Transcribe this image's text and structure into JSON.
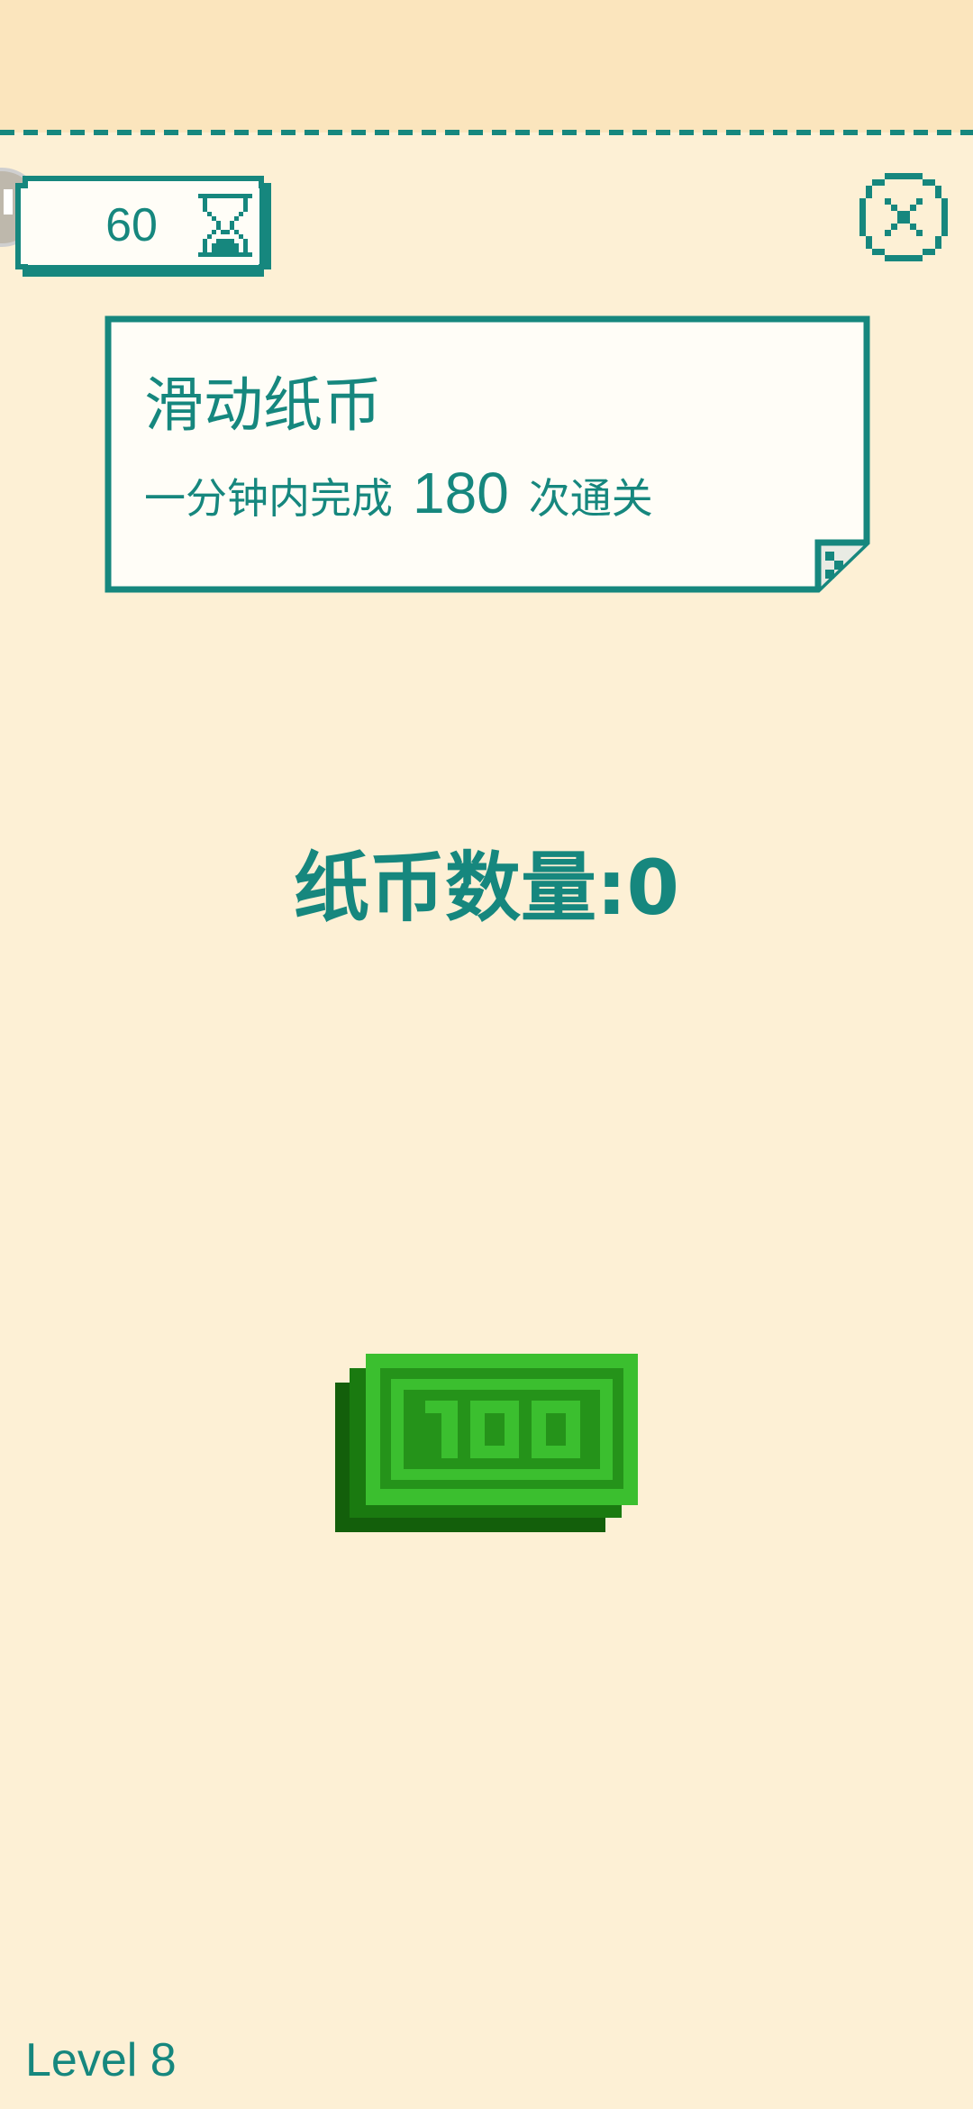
{
  "timer": {
    "value": "60",
    "icon": "hourglass-icon"
  },
  "controls": {
    "pause_icon": "pause-icon",
    "close_icon": "close-icon"
  },
  "task": {
    "title": "滑动纸币",
    "desc_prefix": "一分钟内完成",
    "target": "180",
    "desc_suffix": "次通关"
  },
  "counter": {
    "label": "纸币数量:0"
  },
  "bill": {
    "denomination": "100",
    "icon": "banknote-icon"
  },
  "level": {
    "label": "Level 8"
  },
  "colors": {
    "background": "#fdf0d5",
    "top_band": "#fbe5bd",
    "accent": "#16877e",
    "card_fill": "#fffdf7",
    "bill_light": "#3bbf2f",
    "bill_mid": "#25931a",
    "bill_dark": "#135f0b"
  }
}
